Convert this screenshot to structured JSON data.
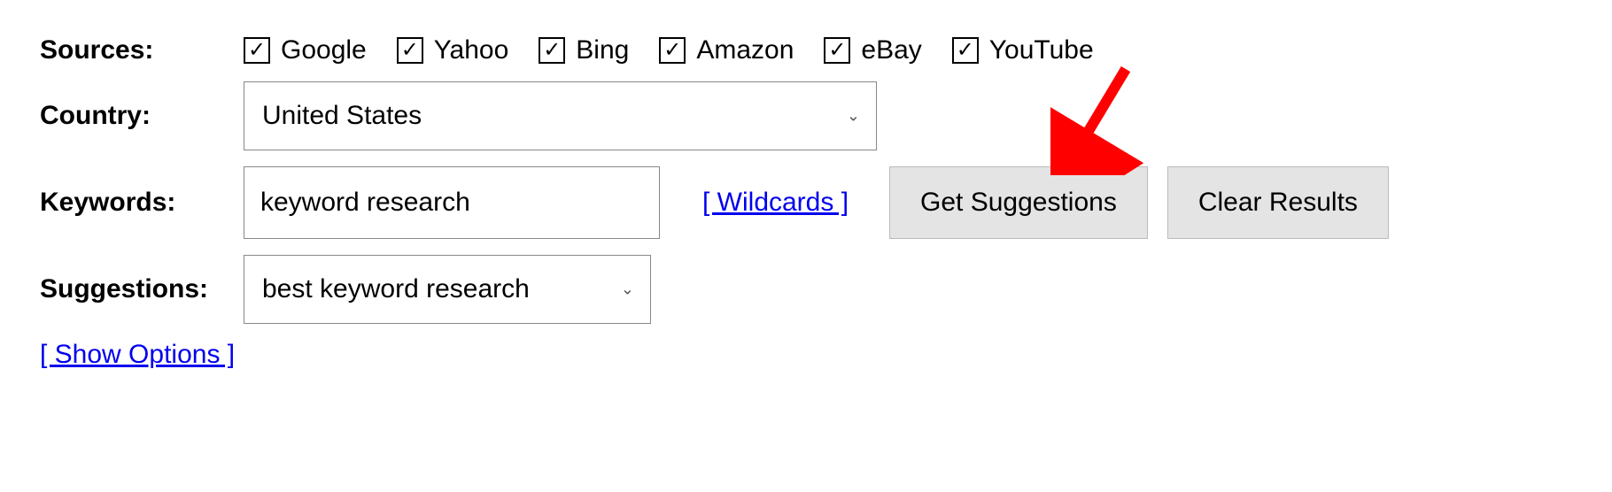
{
  "labels": {
    "sources": "Sources:",
    "country": "Country:",
    "keywords": "Keywords:",
    "suggestions": "Suggestions:"
  },
  "sources": {
    "google": "Google",
    "yahoo": "Yahoo",
    "bing": "Bing",
    "amazon": "Amazon",
    "ebay": "eBay",
    "youtube": "YouTube"
  },
  "country": {
    "selected": "United States"
  },
  "keywords": {
    "value": "keyword research"
  },
  "links": {
    "wildcards": "[ Wildcards ]",
    "show_options": "[ Show Options ]"
  },
  "buttons": {
    "get_suggestions": "Get Suggestions",
    "clear_results": "Clear Results"
  },
  "suggestions": {
    "selected": "best keyword research"
  },
  "checkmark": "✓"
}
